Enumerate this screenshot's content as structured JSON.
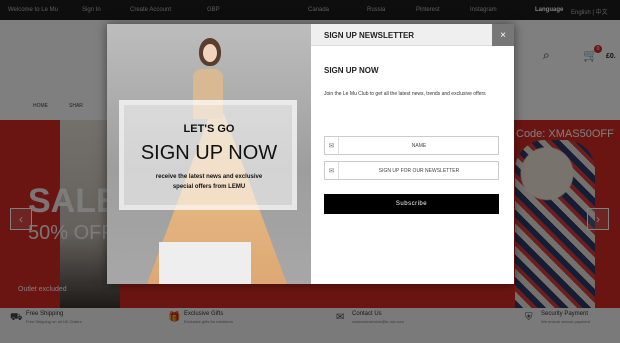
{
  "topbar": {
    "welcome": "Welcome to Le Mu",
    "sign_in": "Sign In",
    "create_account": "Create Account",
    "currency": "GBP",
    "canada": "Canada",
    "russia": "Russia",
    "pinterest": "Pinterest",
    "instagram": "Instagram",
    "language_label": "Language",
    "language_value": "English | 中文"
  },
  "nav": {
    "home": "HOME",
    "item2": "SHAR"
  },
  "hero": {
    "sale": "SALE",
    "percent": "50% OFF",
    "excluded": "Outlet excluded",
    "code": "Code: XMAS50OFF",
    "prev": "‹",
    "next": "›"
  },
  "header": {
    "cart_total": "£0.",
    "cart_count": "0"
  },
  "features": [
    {
      "title": "Free Shipping",
      "sub": "Free Shipping on all UK Orders",
      "icon": "truck-icon"
    },
    {
      "title": "Exclusive Gifts",
      "sub": "Exclusive gifts for members",
      "icon": "gift-icon"
    },
    {
      "title": "Contact Us",
      "sub": "customerservice@le-mu.com",
      "icon": "envelope-icon"
    },
    {
      "title": "Security Payment",
      "sub": "We ensure secure payment",
      "icon": "shield-icon"
    }
  ],
  "modal": {
    "header_title": "SIGN UP NEWSLETTER",
    "close": "×",
    "title": "SIGN UP NOW",
    "text": "Join the Le Mu Club to get all the latest news, trends and exclusive offers",
    "name_placeholder": "NAME",
    "email_placeholder": "SIGN UP FOR OUR NEWSLETTER",
    "subscribe": "Subscribe",
    "promo": {
      "lets_go": "LET'S GO",
      "big": "SIGN UP NOW",
      "sub_line1": "receive the latest news and exclusive",
      "sub_line2": "special offers from LEMU"
    }
  },
  "colors": {
    "hero_bg": "#d62a25",
    "button_bg": "#000000",
    "topbar_bg": "#1c1c1c"
  }
}
